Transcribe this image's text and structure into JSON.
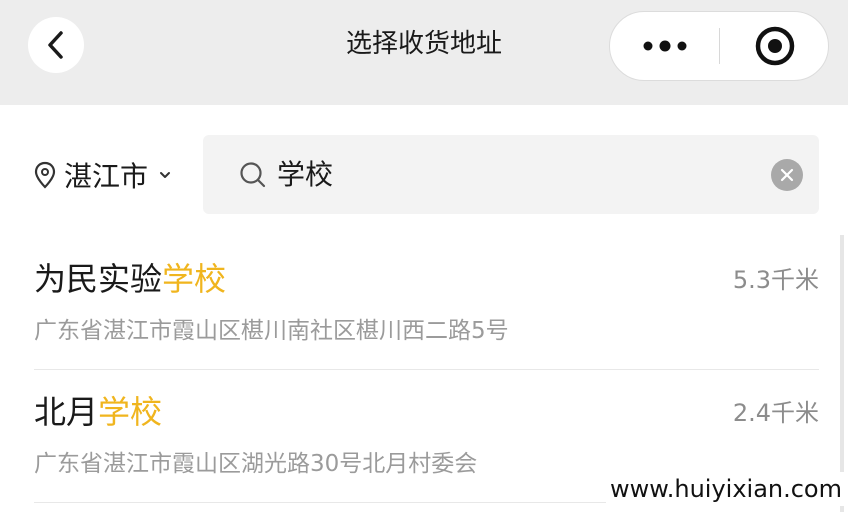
{
  "header": {
    "title": "选择收货地址",
    "back_icon": "chevron-left-icon",
    "more_icon": "more-dots-icon",
    "close_icon": "record-circle-icon"
  },
  "location": {
    "city": "湛江市",
    "pin_icon": "location-pin-icon",
    "dropdown_icon": "chevron-down-icon"
  },
  "search": {
    "value": "学校",
    "icon": "search-icon",
    "clear_icon": "clear-icon"
  },
  "results": [
    {
      "name_prefix": "为民实验",
      "name_highlight": "学校",
      "distance": "5.3千米",
      "address": "广东省湛江市霞山区椹川南社区椹川西二路5号"
    },
    {
      "name_prefix": "北月",
      "name_highlight": "学校",
      "distance": "2.4千米",
      "address": "广东省湛江市霞山区湖光路30号北月村委会"
    }
  ],
  "watermark": "www.huiyixian.com",
  "colors": {
    "highlight": "#f0b51e",
    "topbar_bg": "#ededed",
    "secondary_text": "#9b9b9b"
  }
}
